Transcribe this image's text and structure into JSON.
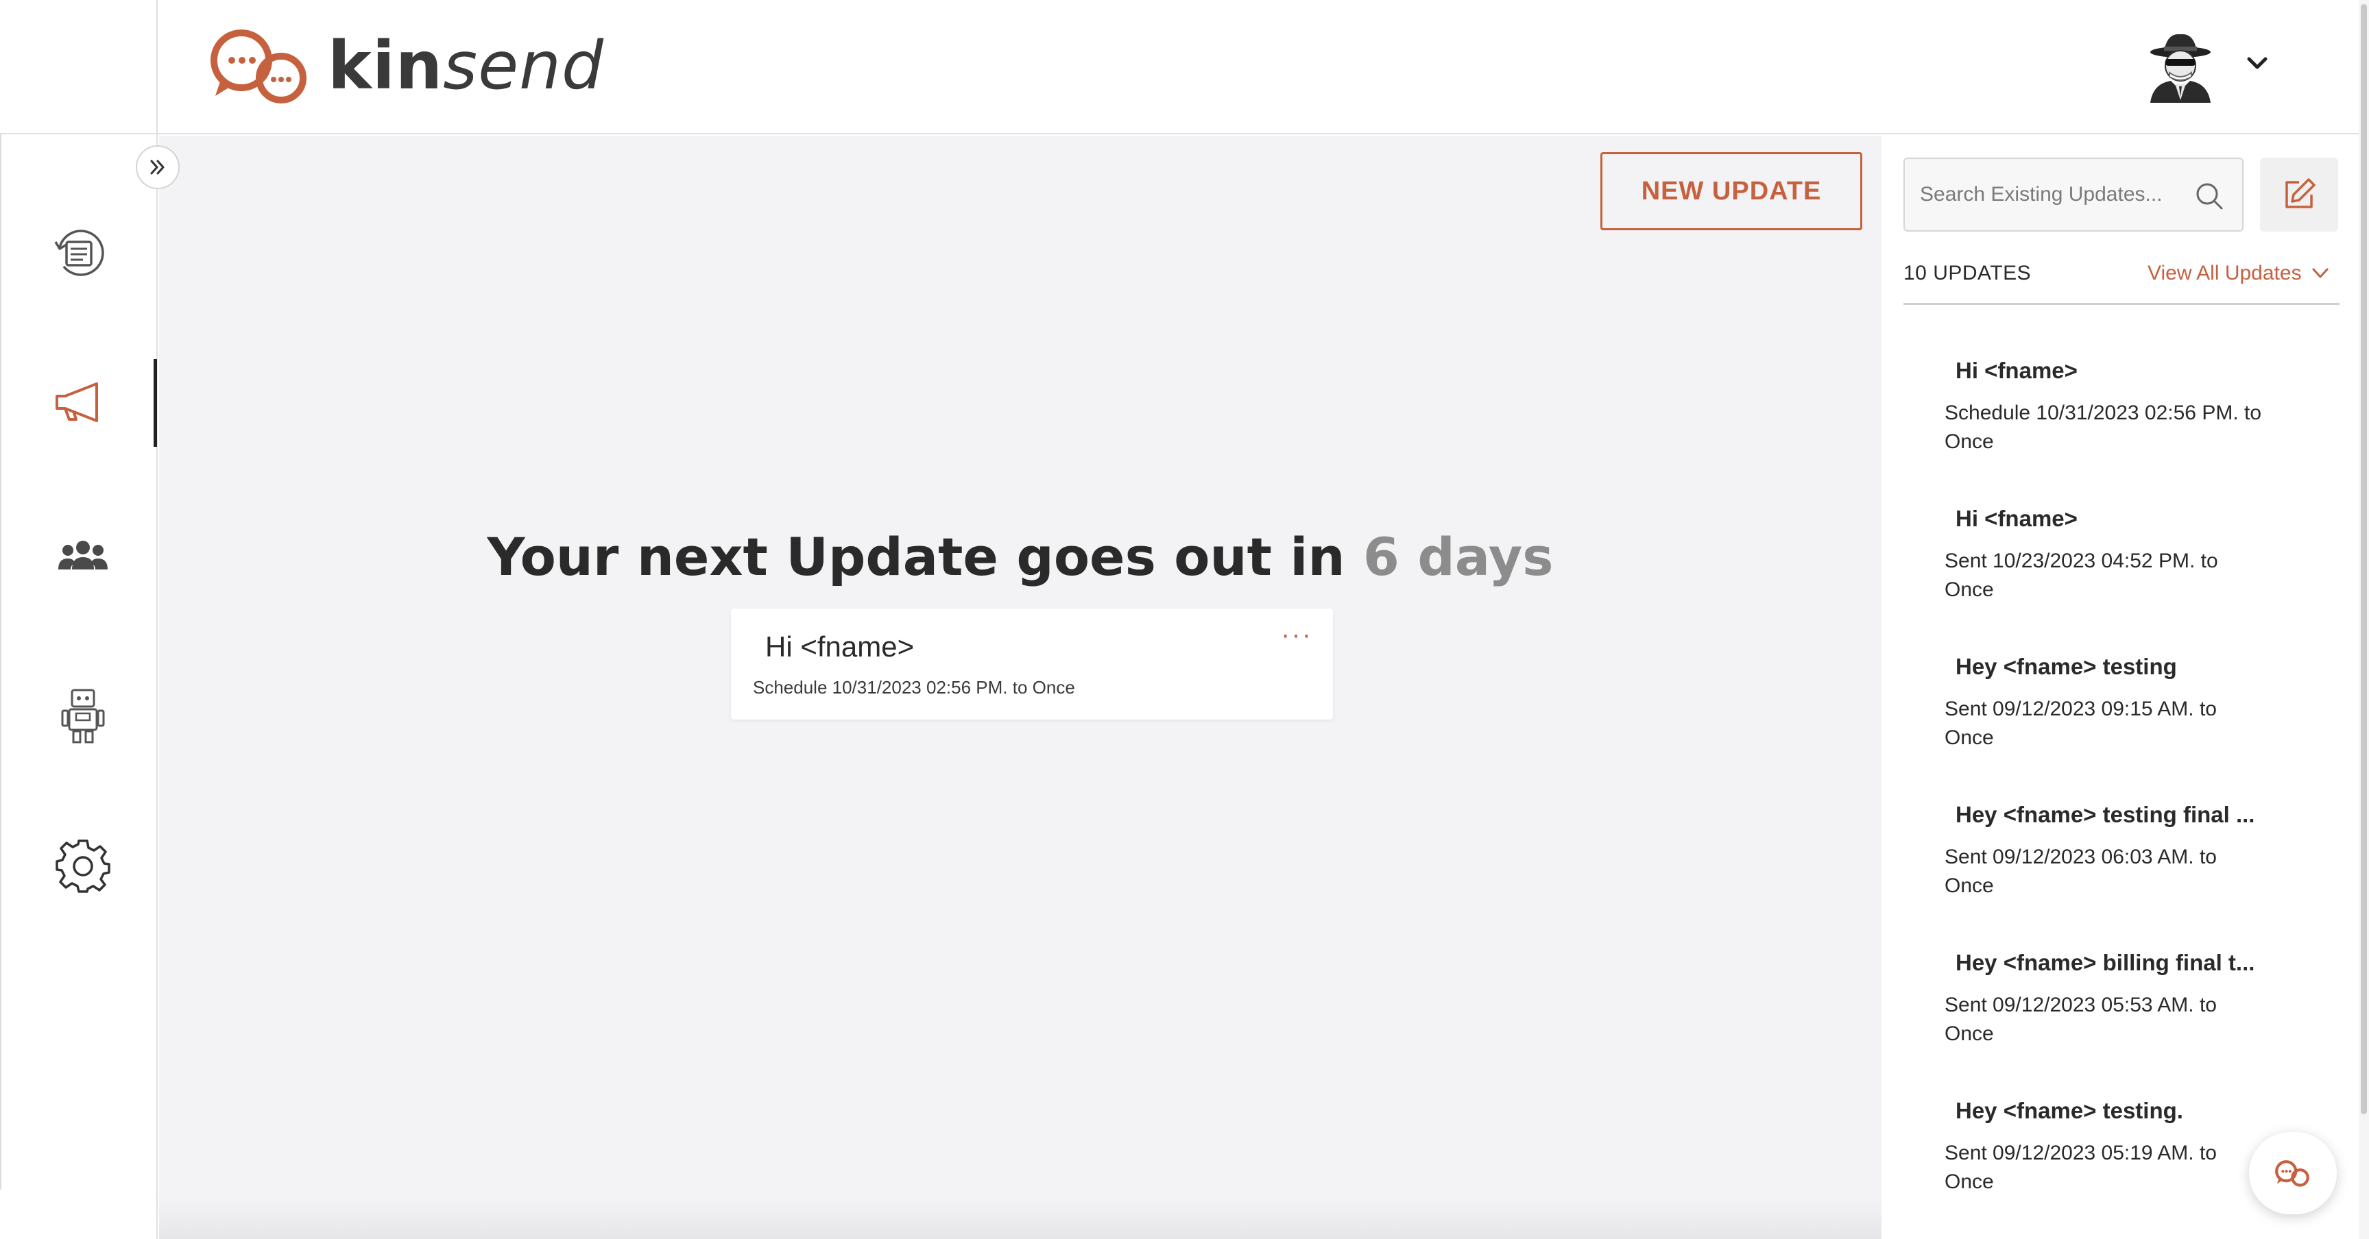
{
  "brand": {
    "name_bold": "kin",
    "name_italic": "send",
    "accent": "#c6613f"
  },
  "header": {
    "avatar_icon": "spy-avatar-icon",
    "menu_icon": "chevron-down-icon"
  },
  "sidebar": {
    "expand_icon": "double-chevron-right-icon",
    "items": [
      {
        "name": "conversations",
        "icon": "message-history-icon",
        "active": false
      },
      {
        "name": "updates",
        "icon": "megaphone-icon",
        "active": true
      },
      {
        "name": "contacts",
        "icon": "people-icon",
        "active": false
      },
      {
        "name": "automations",
        "icon": "robot-icon",
        "active": false
      },
      {
        "name": "settings",
        "icon": "gear-icon",
        "active": false
      }
    ]
  },
  "main": {
    "new_update_label": "NEW UPDATE",
    "headline_prefix": "Your next Update goes out in",
    "headline_days": "6 days",
    "next_update": {
      "title": "Hi <fname>",
      "subtitle": "Schedule 10/31/2023 02:56 PM. to Once",
      "menu_label": "···"
    }
  },
  "panel": {
    "search_placeholder": "Search Existing Updates...",
    "count_label": "10 UPDATES",
    "view_all_label": "View All Updates",
    "updates": [
      {
        "title": "Hi <fname>",
        "line1": "Schedule 10/31/2023 02:56 PM. to",
        "line2": "Once"
      },
      {
        "title": "Hi <fname>",
        "line1": "Sent 10/23/2023 04:52 PM. to",
        "line2": "Once"
      },
      {
        "title": "Hey <fname> testing",
        "line1": "Sent 09/12/2023 09:15 AM. to",
        "line2": "Once"
      },
      {
        "title": "Hey <fname> testing final ...",
        "line1": "Sent 09/12/2023 06:03 AM. to",
        "line2": "Once"
      },
      {
        "title": "Hey <fname> billing final t...",
        "line1": "Sent 09/12/2023 05:53 AM. to",
        "line2": "Once"
      },
      {
        "title": "Hey <fname> testing.",
        "line1": "Sent 09/12/2023 05:19 AM. to",
        "line2": "Once"
      }
    ]
  }
}
